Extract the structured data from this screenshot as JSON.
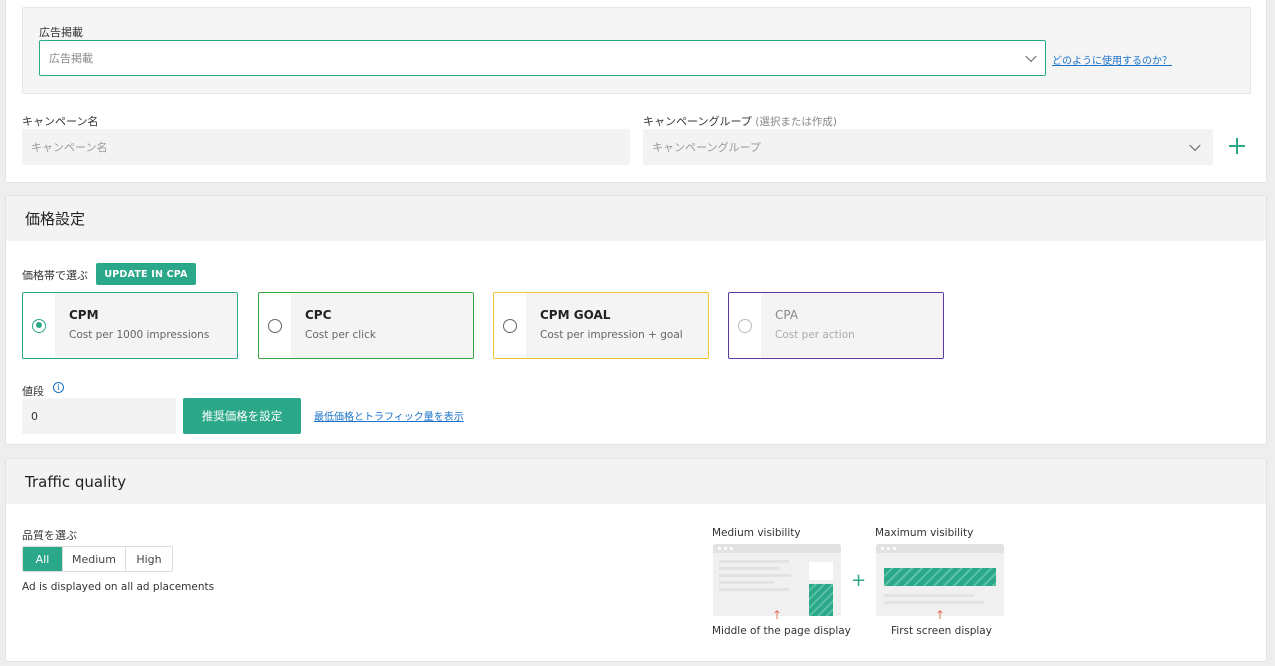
{
  "placement": {
    "label": "広告掲載",
    "placeholder": "広告掲載",
    "help_link": "どのように使用するのか？"
  },
  "campaign_name": {
    "label": "キャンペーン名",
    "placeholder": "キャンペーン名"
  },
  "campaign_group": {
    "label": "キャンペーングループ",
    "label_hint": "(選択または作成)",
    "placeholder": "キャンペーングループ"
  },
  "pricing": {
    "title": "価格設定",
    "select_label": "価格帯で選ぶ",
    "update_button": "UPDATE IN CPA",
    "options": [
      {
        "title": "CPM",
        "subtitle": "Cost per 1000 impressions",
        "border_color": "#2ba889",
        "selected": true
      },
      {
        "title": "CPC",
        "subtitle": "Cost per click",
        "border_color": "#3aa640",
        "selected": false
      },
      {
        "title": "CPM GOAL",
        "subtitle": "Cost per impression + goal",
        "border_color": "#f2c230",
        "selected": false
      },
      {
        "title": "CPA",
        "subtitle": "Cost per action",
        "border_color": "#5b3b9e",
        "selected": false
      }
    ],
    "price_label": "値段",
    "price_value": "0",
    "recommend_button": "推奨価格を設定",
    "traffic_link": "最低価格とトラフィック量を表示"
  },
  "traffic": {
    "title": "Traffic quality",
    "select_label": "品質を選ぶ",
    "segments": [
      "All",
      "Medium",
      "High"
    ],
    "active_segment": "All",
    "description": "Ad is displayed on all ad placements",
    "medium_caption": "Medium visibility",
    "maximum_caption": "Maximum visibility",
    "medium_bottom": "Middle of the page display",
    "maximum_bottom": "First screen display",
    "plus_symbol": "+"
  },
  "colors": {
    "accent": "#2ba889",
    "link": "#1a73c8"
  }
}
